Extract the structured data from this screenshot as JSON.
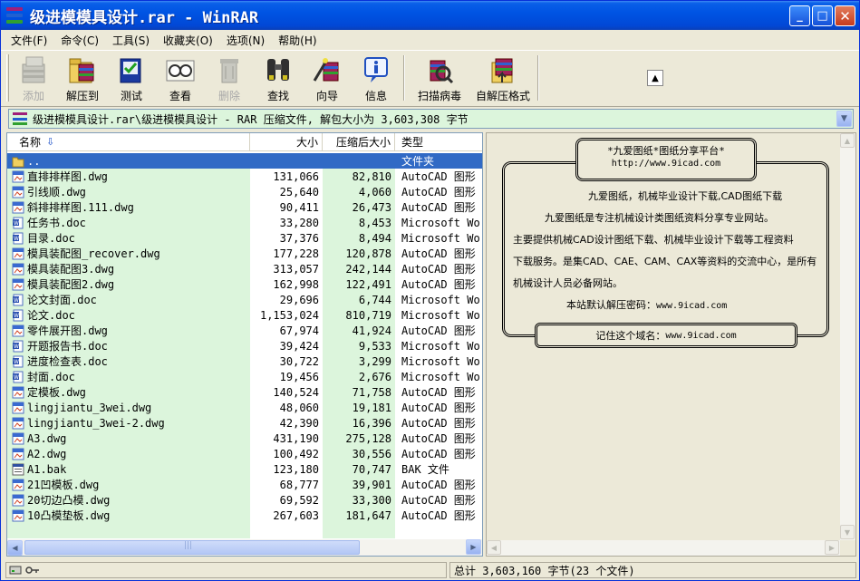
{
  "window": {
    "title": "级进模模具设计.rar - WinRAR",
    "min_label": "_",
    "max_label": "□",
    "close_label": "✕"
  },
  "menu": [
    "文件(F)",
    "命令(C)",
    "工具(S)",
    "收藏夹(O)",
    "选项(N)",
    "帮助(H)"
  ],
  "toolbar": {
    "add": "添加",
    "extract": "解压到",
    "test": "测试",
    "view": "查看",
    "delete": "删除",
    "find": "查找",
    "wizard": "向导",
    "info": "信息",
    "virus": "扫描病毒",
    "sfx": "自解压格式"
  },
  "address": "级进模模具设计.rar\\级进模模具设计 - RAR 压缩文件, 解包大小为 3,603,308 字节",
  "columns": {
    "name": "名称",
    "size": "大小",
    "packed": "压缩后大小",
    "type": "类型"
  },
  "files": [
    {
      "name": "..",
      "size": "",
      "packed": "",
      "type": "文件夹",
      "icon": "folder"
    },
    {
      "name": "直排排样图.dwg",
      "size": "131,066",
      "packed": "82,810",
      "type": "AutoCAD 图形",
      "icon": "dwg"
    },
    {
      "name": "引线顺.dwg",
      "size": "25,640",
      "packed": "4,060",
      "type": "AutoCAD 图形",
      "icon": "dwg"
    },
    {
      "name": "斜排排样图.111.dwg",
      "size": "90,411",
      "packed": "26,473",
      "type": "AutoCAD 图形",
      "icon": "dwg"
    },
    {
      "name": "任务书.doc",
      "size": "33,280",
      "packed": "8,453",
      "type": "Microsoft Wo...",
      "icon": "doc"
    },
    {
      "name": "目录.doc",
      "size": "37,376",
      "packed": "8,494",
      "type": "Microsoft Wo...",
      "icon": "doc"
    },
    {
      "name": "模具装配图_recover.dwg",
      "size": "177,228",
      "packed": "120,878",
      "type": "AutoCAD 图形",
      "icon": "dwg"
    },
    {
      "name": "模具装配图3.dwg",
      "size": "313,057",
      "packed": "242,144",
      "type": "AutoCAD 图形",
      "icon": "dwg"
    },
    {
      "name": "模具装配图2.dwg",
      "size": "162,998",
      "packed": "122,491",
      "type": "AutoCAD 图形",
      "icon": "dwg"
    },
    {
      "name": "论文封面.doc",
      "size": "29,696",
      "packed": "6,744",
      "type": "Microsoft Wo...",
      "icon": "doc"
    },
    {
      "name": "论文.doc",
      "size": "1,153,024",
      "packed": "810,719",
      "type": "Microsoft Wo...",
      "icon": "doc"
    },
    {
      "name": "零件展开图.dwg",
      "size": "67,974",
      "packed": "41,924",
      "type": "AutoCAD 图形",
      "icon": "dwg"
    },
    {
      "name": "开题报告书.doc",
      "size": "39,424",
      "packed": "9,533",
      "type": "Microsoft Wo...",
      "icon": "doc"
    },
    {
      "name": "进度检查表.doc",
      "size": "30,722",
      "packed": "3,299",
      "type": "Microsoft Wo...",
      "icon": "doc"
    },
    {
      "name": "封面.doc",
      "size": "19,456",
      "packed": "2,676",
      "type": "Microsoft Wo...",
      "icon": "doc"
    },
    {
      "name": "定模板.dwg",
      "size": "140,524",
      "packed": "71,758",
      "type": "AutoCAD 图形",
      "icon": "dwg"
    },
    {
      "name": "lingjiantu_3wei.dwg",
      "size": "48,060",
      "packed": "19,181",
      "type": "AutoCAD 图形",
      "icon": "dwg"
    },
    {
      "name": "lingjiantu_3wei-2.dwg",
      "size": "42,390",
      "packed": "16,396",
      "type": "AutoCAD 图形",
      "icon": "dwg"
    },
    {
      "name": "A3.dwg",
      "size": "431,190",
      "packed": "275,128",
      "type": "AutoCAD 图形",
      "icon": "dwg"
    },
    {
      "name": "A2.dwg",
      "size": "100,492",
      "packed": "30,556",
      "type": "AutoCAD 图形",
      "icon": "dwg"
    },
    {
      "name": "A1.bak",
      "size": "123,180",
      "packed": "70,747",
      "type": "BAK 文件",
      "icon": "bak"
    },
    {
      "name": "21凹模板.dwg",
      "size": "68,777",
      "packed": "39,901",
      "type": "AutoCAD 图形",
      "icon": "dwg"
    },
    {
      "name": "20切边凸模.dwg",
      "size": "69,592",
      "packed": "33,300",
      "type": "AutoCAD 图形",
      "icon": "dwg"
    },
    {
      "name": "10凸模垫板.dwg",
      "size": "267,603",
      "packed": "181,647",
      "type": "AutoCAD 图形",
      "icon": "dwg"
    }
  ],
  "comment": {
    "title": "*九爱图纸*图纸分享平台*",
    "url": "http://www.9icad.com",
    "line1": "九爱图纸，机械毕业设计下载,CAD图纸下载",
    "line2": "九爱图纸是专注机械设计类图纸资料分享专业网站。",
    "line3": "主要提供机械CAD设计图纸下载、机械毕业设计下载等工程资料",
    "line4": "下载服务。是集CAD、CAE、CAM、CAX等资料的交流中心，是所有",
    "line5": "机械设计人员必备网站。",
    "password_label": "本站默认解压密码：",
    "password": "www.9icad.com",
    "footer_label": "记住这个域名：",
    "footer_domain": "www.9icad.com"
  },
  "status": {
    "total": "总计 3,603,160 字节(23 个文件)"
  },
  "colors": {
    "selection": "#316ac5",
    "list_green": "#dcf5dc",
    "titlebar": "#0054e3"
  }
}
